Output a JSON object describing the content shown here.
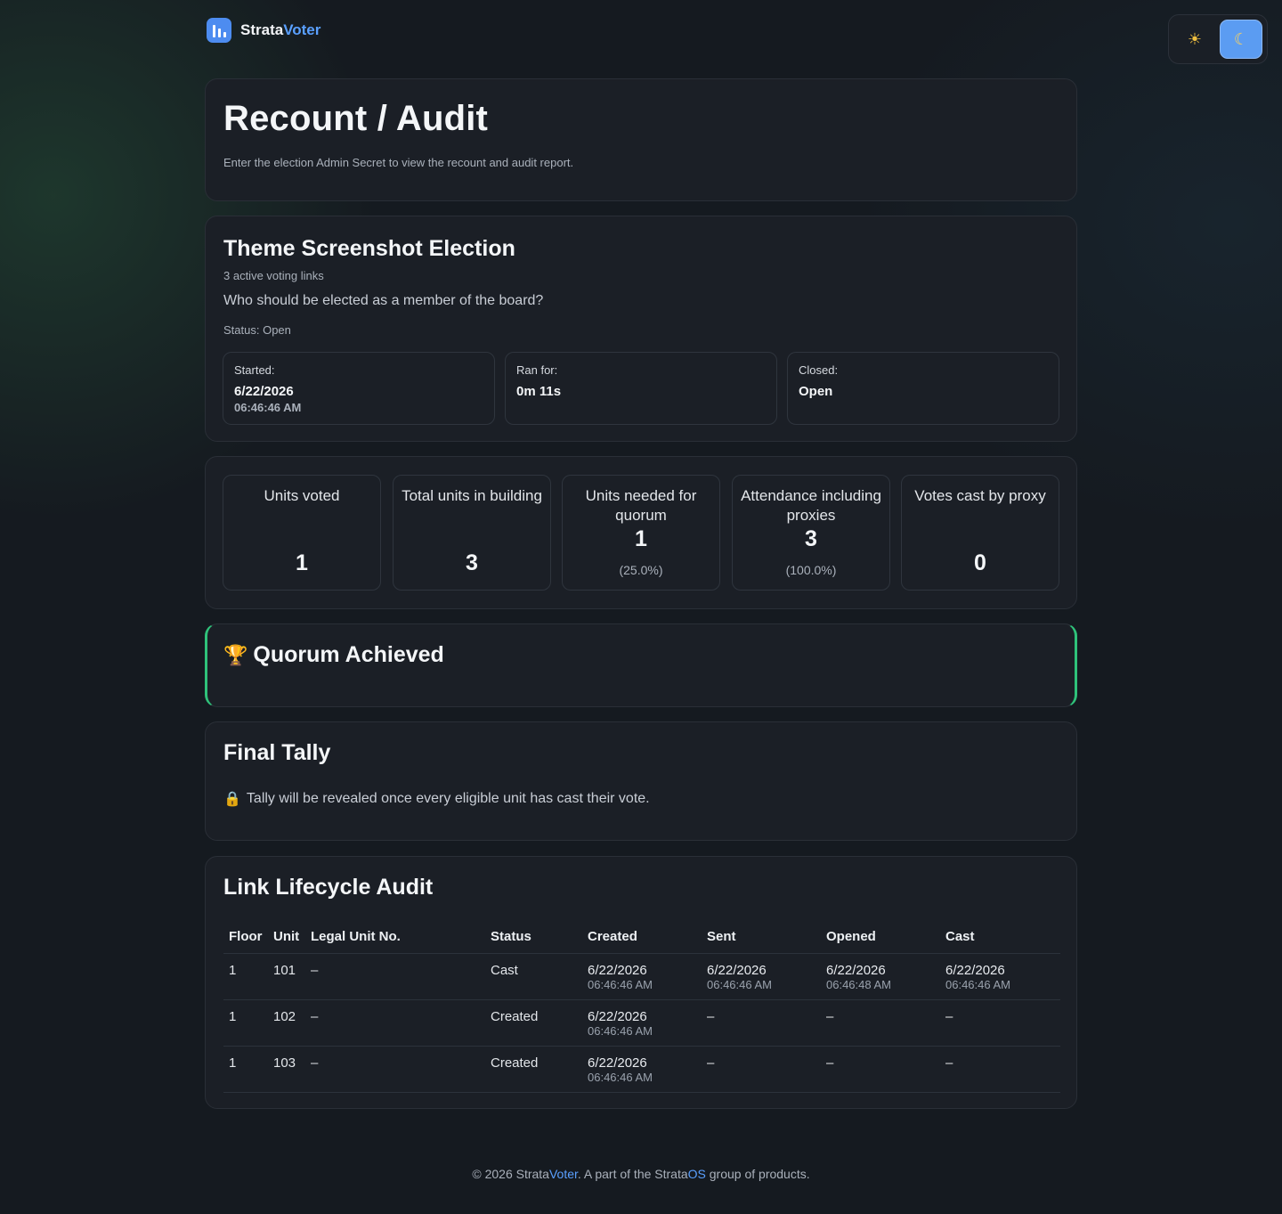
{
  "brand": {
    "name_part1": "Strata",
    "name_part2": "Voter"
  },
  "theme_toggle": {
    "light_icon": "sun-icon",
    "dark_icon": "moon-icon",
    "light_glyph": "☀",
    "dark_glyph": "☾",
    "active": "dark"
  },
  "header": {
    "title": "Recount / Audit",
    "subtitle": "Enter the election Admin Secret to view the recount and audit report."
  },
  "election": {
    "name": "Theme Screenshot Election",
    "links": "3 active voting links",
    "question": "Who should be elected as a member of the board?",
    "status": "Status: Open",
    "started_label": "Started:",
    "started_date": "6/22/2026",
    "started_time": "06:46:46 AM",
    "ran_for_label": "Ran for:",
    "ran_for_value": "0m 11s",
    "closed_label": "Closed:",
    "closed_value": "Open"
  },
  "metrics": [
    {
      "label": "Units voted",
      "value": "1",
      "pct": ""
    },
    {
      "label": "Total units in building",
      "value": "3",
      "pct": ""
    },
    {
      "label": "Units needed for quorum",
      "value": "1",
      "pct": "(25.0%)"
    },
    {
      "label": "Attendance including proxies",
      "value": "3",
      "pct": "(100.0%)"
    },
    {
      "label": "Votes cast by proxy",
      "value": "0",
      "pct": ""
    }
  ],
  "quorum": {
    "icon": "trophy-icon",
    "glyph": "🏆",
    "text": "Quorum Achieved",
    "accent": "#2fc27a"
  },
  "tally": {
    "title": "Final Tally",
    "icon": "lock-icon",
    "glyph": "🔒",
    "message": "Tally will be revealed once every eligible unit has cast their vote."
  },
  "audit": {
    "title": "Link Lifecycle Audit",
    "columns": [
      "Floor",
      "Unit",
      "Legal Unit No.",
      "Status",
      "Created",
      "Sent",
      "Opened",
      "Cast"
    ],
    "rows": [
      {
        "floor": "1",
        "unit": "101",
        "legal": "–",
        "status": "Cast",
        "created": [
          "6/22/2026",
          "06:46:46 AM"
        ],
        "sent": [
          "6/22/2026",
          "06:46:46 AM"
        ],
        "opened": [
          "6/22/2026",
          "06:46:48 AM"
        ],
        "cast": [
          "6/22/2026",
          "06:46:46 AM"
        ]
      },
      {
        "floor": "1",
        "unit": "102",
        "legal": "–",
        "status": "Created",
        "created": [
          "6/22/2026",
          "06:46:46 AM"
        ],
        "sent": [
          "–",
          ""
        ],
        "opened": [
          "–",
          ""
        ],
        "cast": [
          "–",
          ""
        ]
      },
      {
        "floor": "1",
        "unit": "103",
        "legal": "–",
        "status": "Created",
        "created": [
          "6/22/2026",
          "06:46:46 AM"
        ],
        "sent": [
          "–",
          ""
        ],
        "opened": [
          "–",
          ""
        ],
        "cast": [
          "–",
          ""
        ]
      }
    ]
  },
  "footer": {
    "prefix": "© 2026 Strata",
    "brand_accent": "Voter",
    "middle": ". A part of the Strata",
    "os_accent": "OS",
    "suffix": " group of products."
  }
}
